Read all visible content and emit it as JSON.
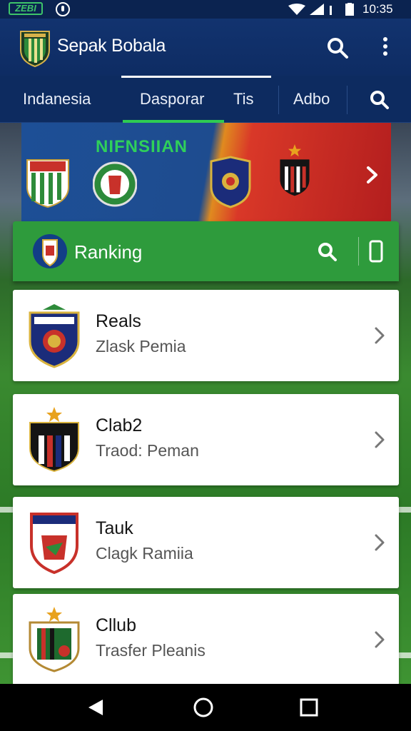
{
  "status_bar": {
    "badge": "ZEBI",
    "time": "10:35"
  },
  "app_bar": {
    "title": "Sepak Bobala"
  },
  "tabs": [
    {
      "label": "Indanesia"
    },
    {
      "label": "Dasporar"
    },
    {
      "label": "Tis"
    },
    {
      "label": "Adbo"
    }
  ],
  "banner": {
    "title": "NIFNSIIAN"
  },
  "ranking": {
    "title": "Ranking"
  },
  "clubs": [
    {
      "name": "Reals",
      "subtitle": "Zlask Pemia"
    },
    {
      "name": "Clab2",
      "subtitle": "Traod: Peman"
    },
    {
      "name": "Tauk",
      "subtitle": "Clagk Ramiia"
    },
    {
      "name": "Cllub",
      "subtitle": "Trasfer Pleanis"
    }
  ],
  "colors": {
    "primary": "#12336f",
    "accent": "#2ecc52",
    "ranking_header": "#2e9b3c"
  },
  "icons": {
    "app_bar": [
      "club-logo-icon",
      "search-icon",
      "more-vertical-icon"
    ],
    "tabs": [
      "search-icon"
    ],
    "ranking": [
      "ranking-logo-icon",
      "search-icon",
      "phone-icon"
    ],
    "nav": [
      "back-icon",
      "home-icon",
      "recent-apps-icon"
    ]
  }
}
